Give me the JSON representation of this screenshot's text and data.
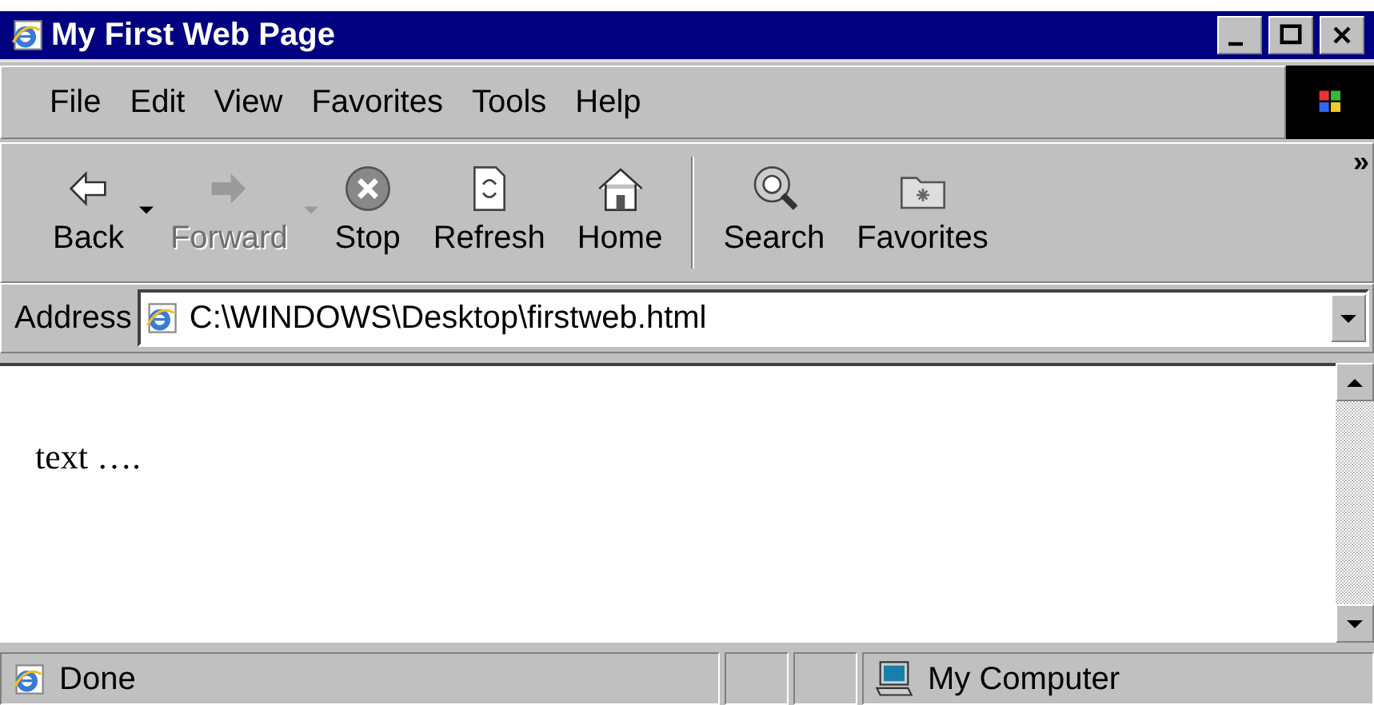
{
  "window": {
    "title": "My First Web Page"
  },
  "menu": [
    "File",
    "Edit",
    "View",
    "Favorites",
    "Tools",
    "Help"
  ],
  "toolbar": [
    {
      "label": "Back",
      "kind": "back",
      "disabled": false,
      "dropdown": true
    },
    {
      "label": "Forward",
      "kind": "forward",
      "disabled": true,
      "dropdown": true
    },
    {
      "label": "Stop",
      "kind": "stop",
      "disabled": false,
      "dropdown": false
    },
    {
      "label": "Refresh",
      "kind": "refresh",
      "disabled": false,
      "dropdown": false
    },
    {
      "label": "Home",
      "kind": "home",
      "disabled": false,
      "dropdown": false
    },
    {
      "label": "Search",
      "kind": "search",
      "disabled": false,
      "dropdown": false
    },
    {
      "label": "Favorites",
      "kind": "favorites",
      "disabled": false,
      "dropdown": false
    }
  ],
  "toolbar_more": "»",
  "address": {
    "label": "Address",
    "value": "C:\\WINDOWS\\Desktop\\firstweb.html"
  },
  "content": {
    "text": "text …."
  },
  "status_bar": {
    "text": "Done",
    "zone": "My Computer"
  }
}
